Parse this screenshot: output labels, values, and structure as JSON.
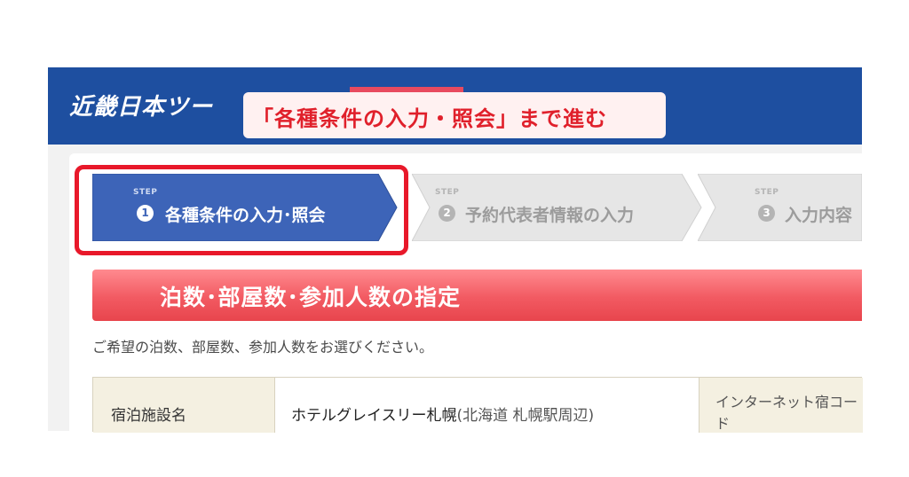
{
  "header": {
    "logo_text": "近畿日本ツー",
    "brand_color": "#1e4fa0",
    "accent_color": "#e84a5f"
  },
  "callout": {
    "text": "「各種条件の入力・照会」まで進む",
    "text_color": "#e0202b",
    "highlight_color": "#e8182a"
  },
  "steps": [
    {
      "step_word": "STEP",
      "number": "1",
      "label": "各種条件の入力･照会",
      "state": "active",
      "color": "#3d64b8"
    },
    {
      "step_word": "STEP",
      "number": "2",
      "label": "予約代表者情報の入力",
      "state": "inactive",
      "color": "#e6e6e6"
    },
    {
      "step_word": "STEP",
      "number": "3",
      "label": "入力内容",
      "state": "inactive",
      "color": "#e6e6e6"
    }
  ],
  "section": {
    "title": "泊数･部屋数･参加人数の指定",
    "color": "#f25a62"
  },
  "instruction": "ご希望の泊数、部屋数、参加人数をお選びください。",
  "table": {
    "row1": {
      "label": "宿泊施設名",
      "value": "ホテルグレイスリー札幌",
      "location": "(北海道 札幌駅周辺)",
      "code_label_line1": "インターネット宿コー",
      "code_label_line2": "ド"
    }
  }
}
